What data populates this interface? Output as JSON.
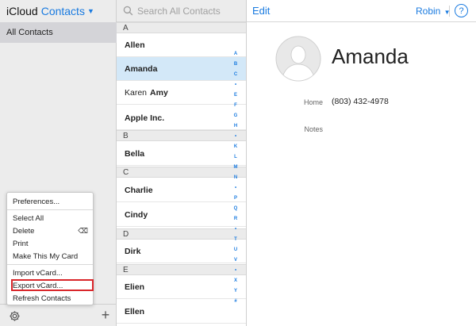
{
  "sidebar": {
    "brand": "iCloud",
    "app_name": "Contacts",
    "selected_group": "All Contacts"
  },
  "menu": {
    "preferences": "Preferences...",
    "select_all": "Select All",
    "delete": "Delete",
    "print": "Print",
    "make_my_card": "Make This My Card",
    "import_vcard": "Import vCard...",
    "export_vcard": "Export vCard...",
    "refresh": "Refresh Contacts"
  },
  "list": {
    "search_placeholder": "Search All Contacts",
    "sections": [
      "A",
      "B",
      "C",
      "D",
      "E"
    ],
    "contacts": [
      {
        "first": "",
        "last": "Allen"
      },
      {
        "first": "",
        "last": "Amanda"
      },
      {
        "first": "Karen",
        "last": "Amy"
      },
      {
        "first": "",
        "last": "Apple Inc."
      },
      {
        "first": "",
        "last": "Bella"
      },
      {
        "first": "",
        "last": "Charlie"
      },
      {
        "first": "",
        "last": "Cindy"
      },
      {
        "first": "",
        "last": "Dirk"
      },
      {
        "first": "",
        "last": "Elien"
      },
      {
        "first": "",
        "last": "Ellen"
      }
    ],
    "index_letters": [
      "A",
      "B",
      "C",
      "•",
      "E",
      "F",
      "G",
      "H",
      "•",
      "K",
      "L",
      "M",
      "N",
      "•",
      "P",
      "Q",
      "R",
      "•",
      "T",
      "U",
      "V",
      "•",
      "X",
      "Y",
      "#"
    ]
  },
  "detail": {
    "edit_label": "Edit",
    "user_name": "Robin",
    "help_label": "?",
    "contact_name": "Amanda",
    "home_label": "Home",
    "home_phone": "(803) 432-4978",
    "notes_label": "Notes"
  },
  "colors": {
    "accent": "#1a7be0",
    "selection": "#d3e8f8",
    "highlight_box": "#d9262a"
  },
  "icons": [
    "search-icon",
    "gear-icon",
    "plus-icon",
    "chevron-down-icon",
    "delete-icon",
    "avatar-icon",
    "help-icon"
  ]
}
